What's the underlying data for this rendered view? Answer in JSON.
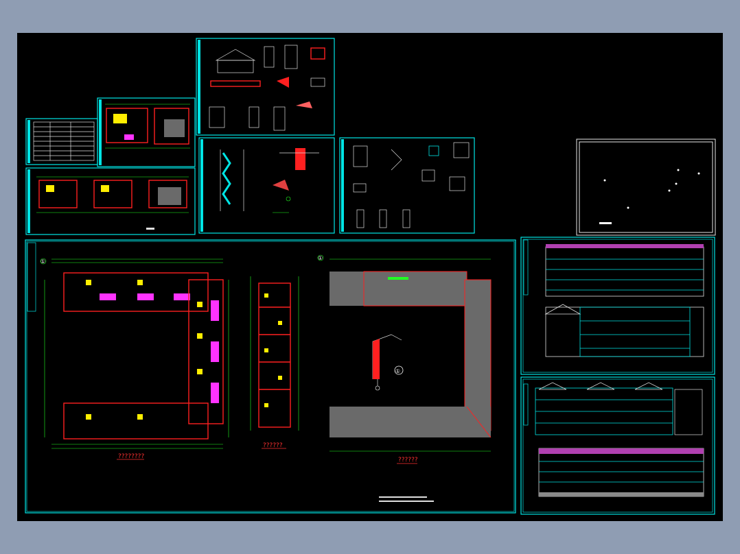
{
  "window": {
    "background": "#8f9db3",
    "canvas_background": "#000000"
  },
  "colors": {
    "frame": "#00e5e5",
    "wall": "#ff2020",
    "grid": "#1fff1f",
    "title_red": "#ff3030"
  },
  "drawing": {
    "main_sheet": {
      "axis_markers": [
        "①",
        "①"
      ],
      "plan_titles": [
        "????????",
        "??????",
        "??????"
      ]
    },
    "detail_marker": "①"
  }
}
